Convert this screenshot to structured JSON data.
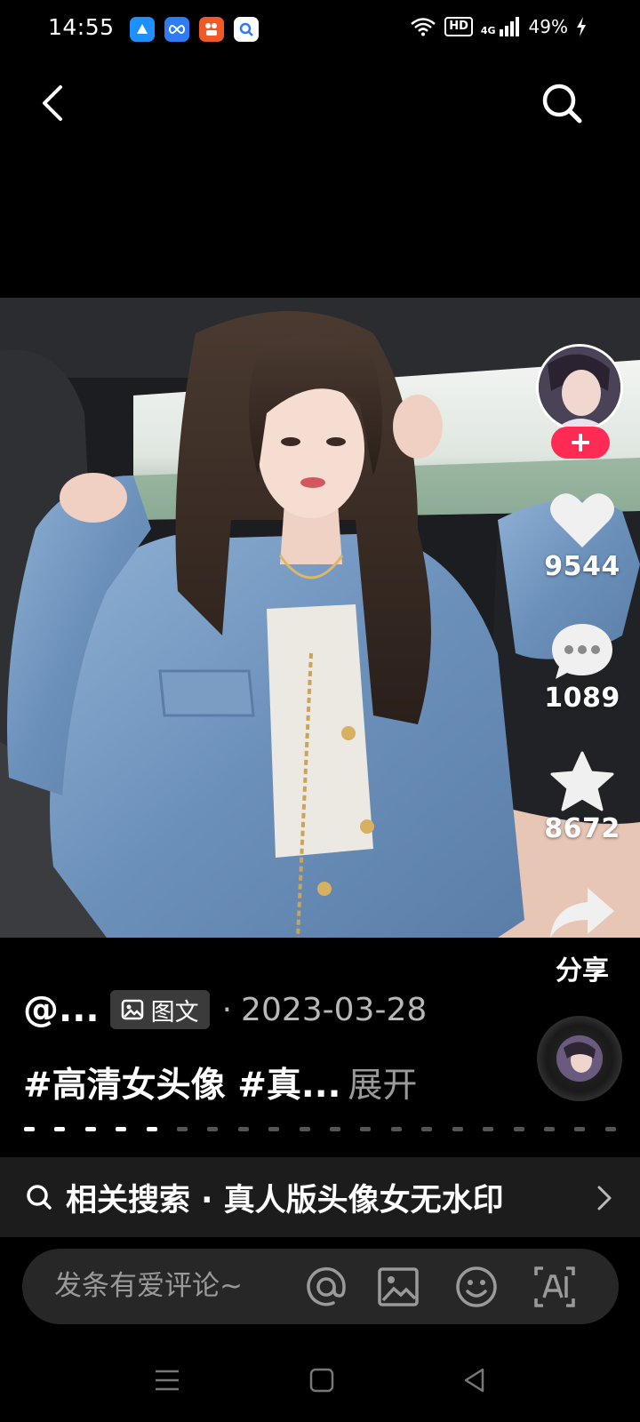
{
  "status_bar": {
    "time": "14:55",
    "battery": "49%",
    "network": "4G",
    "hd": "HD"
  },
  "post": {
    "author": "@...",
    "type_label": "图文",
    "date": "2023-03-28",
    "date_separator": "·",
    "caption": "#高清女头像 #真...",
    "expand_label": "展开"
  },
  "actions": {
    "likes": "9544",
    "comments": "1089",
    "favorites": "8672",
    "share_label": "分享"
  },
  "related_search": {
    "text": "相关搜索 · 真人版头像女无水印"
  },
  "comment_bar": {
    "placeholder": "发条有爱评论~"
  },
  "progress": {
    "total_pages": 20,
    "current_page": 5
  },
  "colors": {
    "accent": "#fe2c55",
    "background": "#000000"
  }
}
